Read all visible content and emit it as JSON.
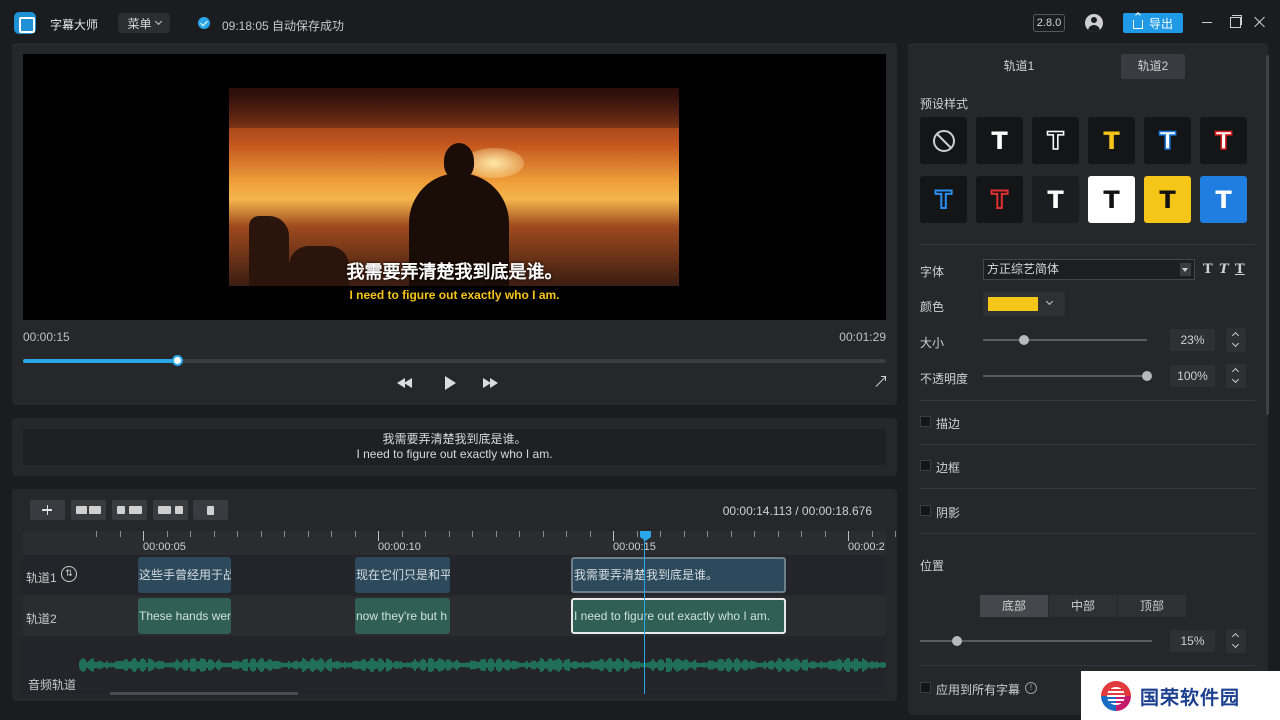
{
  "titlebar": {
    "app_name": "字幕大师",
    "menu_label": "菜单",
    "save_status": "09:18:05 自动保存成功",
    "version": "2.8.0",
    "export_label": "导出"
  },
  "player": {
    "subtitle_cn": "我需要弄清楚我到底是谁。",
    "subtitle_en": "I need to figure out exactly who I am.",
    "current_time": "00:00:15",
    "total_time": "00:01:29",
    "progress_fraction": 0.178
  },
  "text_preview": {
    "line1": "我需要弄清楚我到底是谁。",
    "line2": "I need to figure out exactly who I am."
  },
  "timeline": {
    "time_display": "00:00:14.113  /  00:00:18.676",
    "ruler_labels": [
      "00:00:05",
      "00:00:10",
      "00:00:15",
      "00:00:2"
    ],
    "track1_label": "轨道1",
    "track1_icon": "⇅",
    "track2_label": "轨道2",
    "audio_label": "音频轨道",
    "track1_clips": [
      "这些手曾经用于战",
      "现在它们只是和平",
      "我需要弄清楚我到底是谁。"
    ],
    "track2_clips": [
      "These hands wer",
      "now they're but h",
      "I need to figure out exactly who I am."
    ]
  },
  "style_panel": {
    "tabs": [
      "轨道1",
      "轨道2"
    ],
    "active_tab": "轨道2",
    "preset_title": "预设样式",
    "preset_glyph": "T",
    "font_label": "字体",
    "font_value": "方正综艺简体",
    "font_style_glyphs": [
      "T",
      "T",
      "T"
    ],
    "color_label": "颜色",
    "color_value": "#f5c518",
    "size_label": "大小",
    "size_value": "23%",
    "opacity_label": "不透明度",
    "opacity_value": "100%",
    "stroke_label": "描边",
    "border_label": "边框",
    "shadow_label": "阴影",
    "position_title": "位置",
    "position_options": [
      "底部",
      "中部",
      "顶部"
    ],
    "position_active": "底部",
    "offset_value": "15%",
    "apply_all_label": "应用到所有字幕",
    "info_glyph": "!"
  },
  "watermark": {
    "text": "国荣软件园"
  },
  "colors": {
    "accent": "#2aa7e8",
    "subtitle_yellow": "#f5c518"
  }
}
